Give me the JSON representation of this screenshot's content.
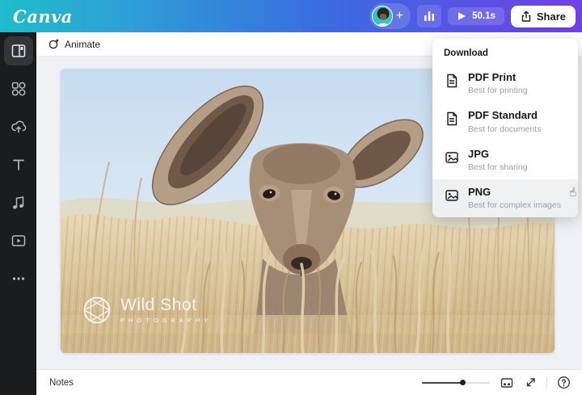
{
  "header": {
    "logo": "Canva",
    "plus_glyph": "+",
    "duration": "50.1s",
    "share_label": "Share",
    "icons": [
      "avatar",
      "plus-icon",
      "bar-chart-icon",
      "play-icon",
      "share-upload-icon"
    ],
    "colors": {
      "gradient_start": "#1fbccb",
      "gradient_mid": "#3a6ce0",
      "gradient_end": "#7040e8",
      "share_bg": "#ffffff"
    }
  },
  "sidebar": {
    "icons": [
      "templates-panel-icon",
      "elements-icon",
      "uploads-cloud-icon",
      "text-icon",
      "audio-note-icon",
      "videos-icon",
      "more-dots-icon"
    ],
    "active_index": 0,
    "colors": {
      "bg": "#1b1c1e",
      "icon": "#b6b8bd",
      "active_bg": "#333539"
    }
  },
  "toolbar": {
    "animate_label": "Animate"
  },
  "canvas": {
    "photo_subject": "young kudu antelope peeking above dry golden grass against blue sky",
    "watermark_title": "Wild Shot",
    "watermark_subtitle": "PHOTOGRAPHY"
  },
  "download_menu": {
    "title": "Download",
    "pointer_glyph": "☝",
    "items": [
      {
        "label": "PDF Print",
        "description": "Best for printing",
        "icon": "pdf-file-icon",
        "selected": false
      },
      {
        "label": "PDF Standard",
        "description": "Best for documents",
        "icon": "pdf-file-icon",
        "selected": false
      },
      {
        "label": "JPG",
        "description": "Best for sharing",
        "icon": "image-file-icon",
        "selected": false
      },
      {
        "label": "PNG",
        "description": "Best for complex images",
        "icon": "image-file-icon",
        "selected": true
      }
    ],
    "colors": {
      "selected_row_bg": "#eef0f2"
    }
  },
  "footer": {
    "notes_label": "Notes",
    "help_glyph": "?",
    "icons": [
      "zoom-slider",
      "pages-grid-icon",
      "fullscreen-icon",
      "help-icon"
    ],
    "zoom_slider_percent": 57
  }
}
